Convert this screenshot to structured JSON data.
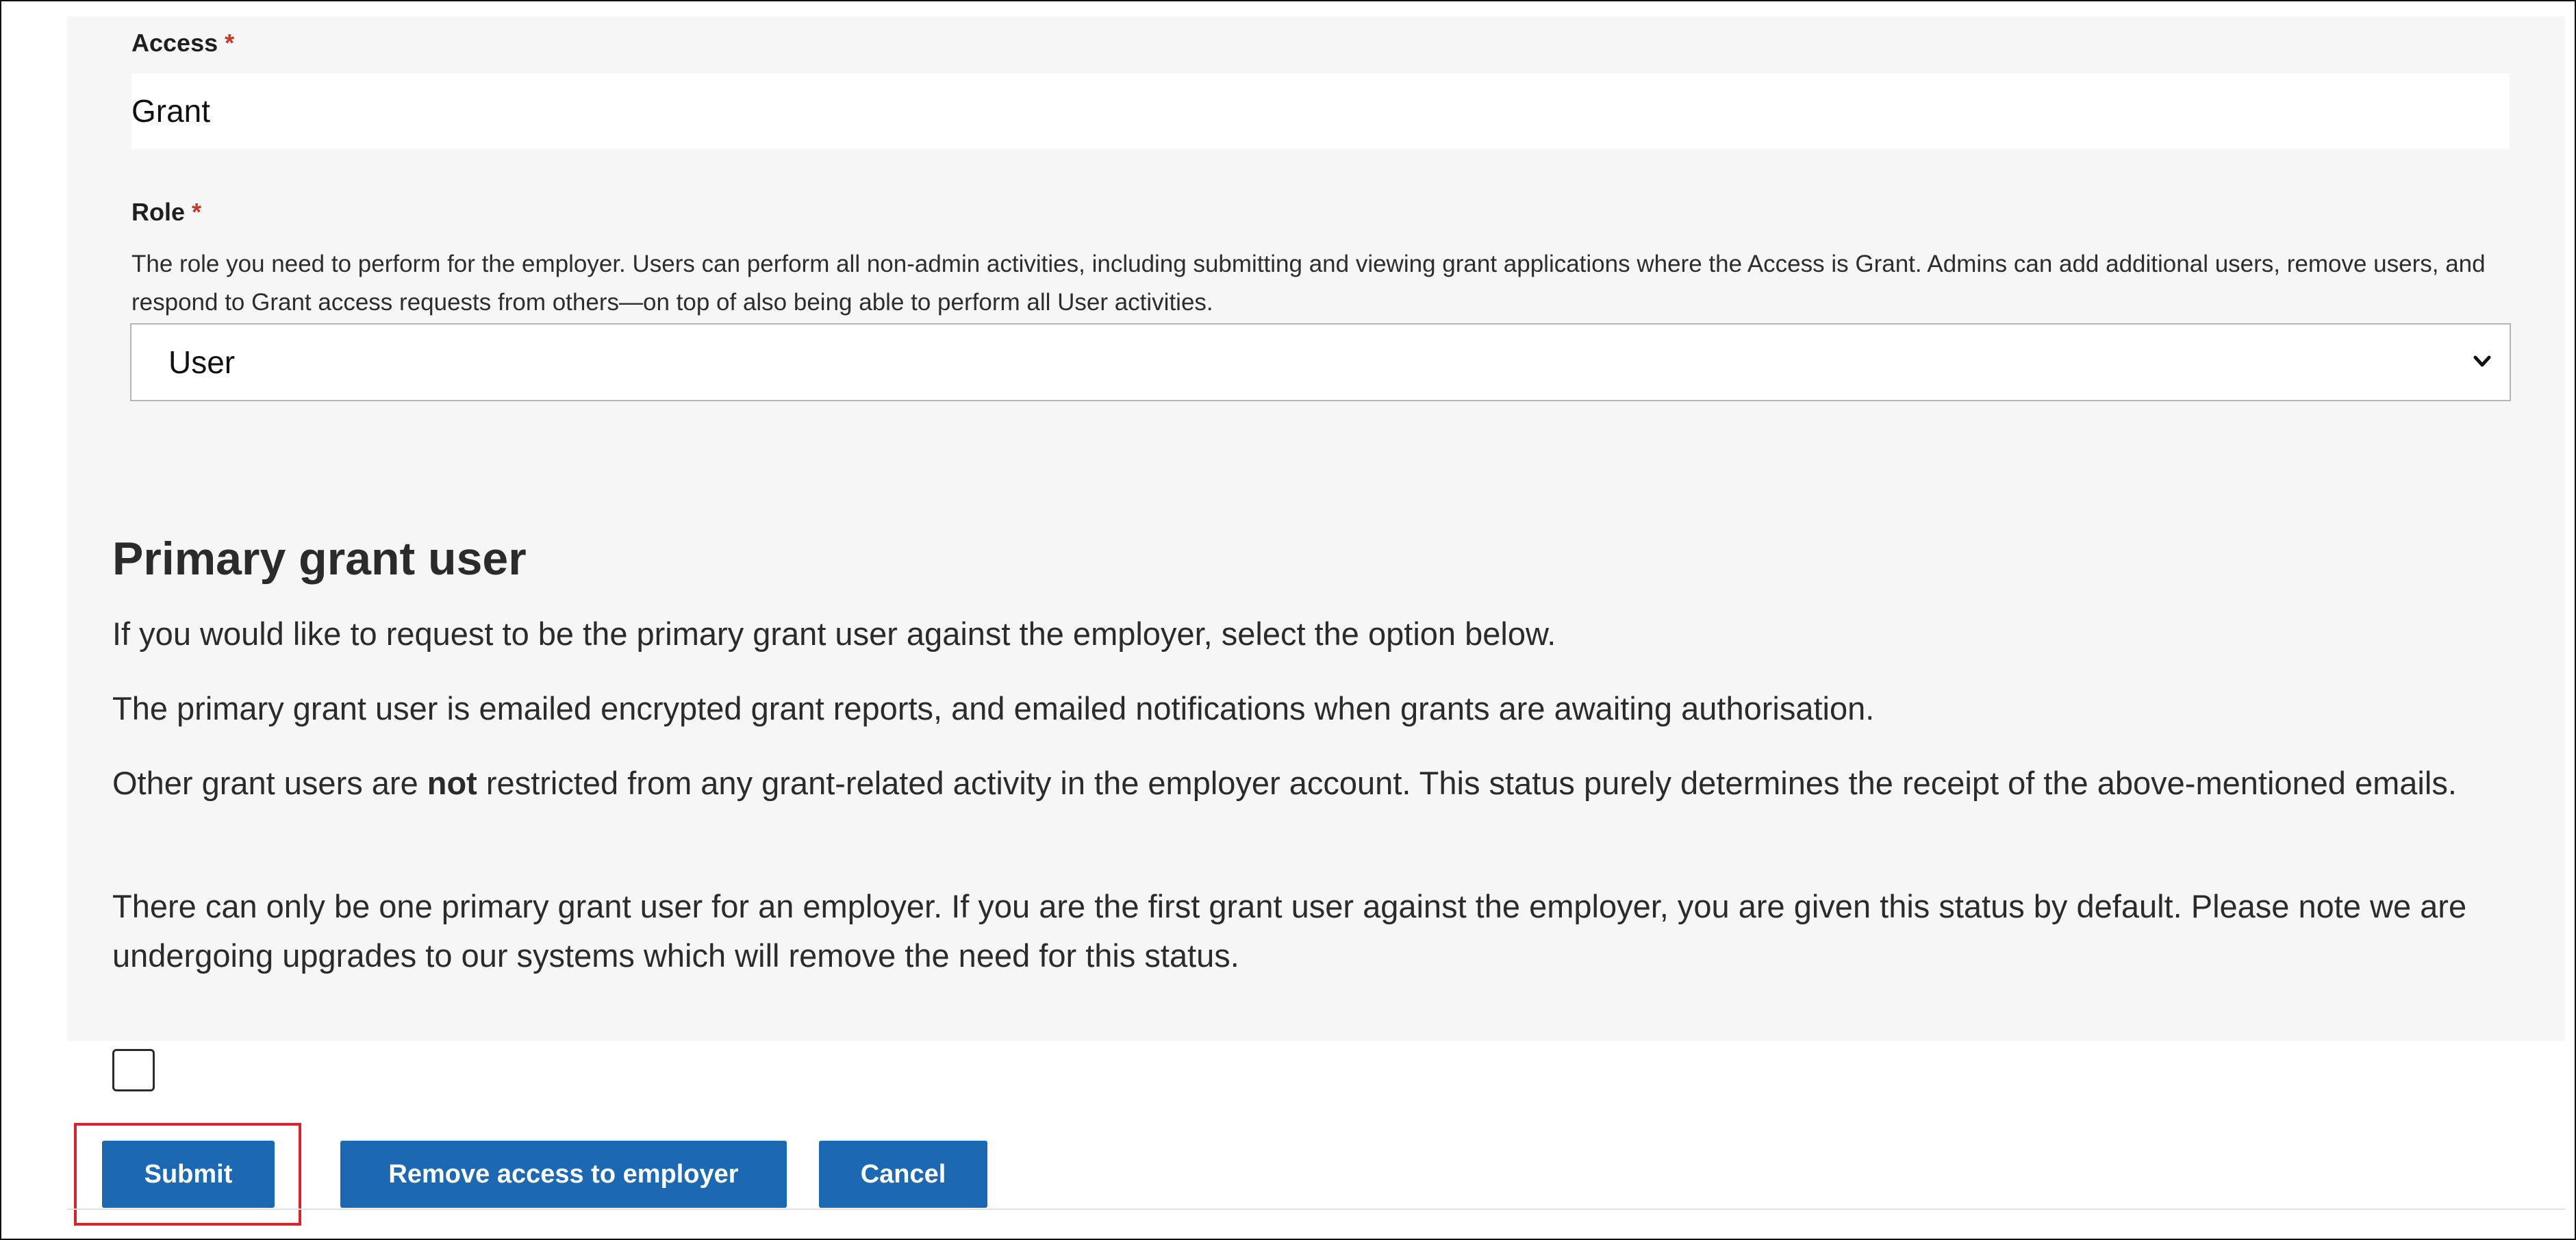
{
  "form": {
    "access": {
      "label": "Access",
      "required_marker": "*",
      "value": "Grant"
    },
    "role": {
      "label": "Role",
      "required_marker": "*",
      "hint": "The role you need to perform for the employer. Users can perform all non-admin activities, including submitting and viewing grant applications where the Access is Grant. Admins can add additional users, remove users, and respond to Grant access requests from others—on top of also being able to perform all User activities.",
      "selected": "User"
    }
  },
  "primary_grant": {
    "heading": "Primary grant user",
    "p1": "If you would like to request to be the primary grant user against the employer, select the option below.",
    "p2": "The primary grant user is emailed encrypted grant reports, and emailed notifications when grants are awaiting authorisation.",
    "p3_before": "Other grant users are ",
    "p3_bold": "not",
    "p3_after": " restricted from any grant-related activity in the employer account. This status purely determines the receipt of the above-mentioned emails.",
    "p4": "There can only be one primary grant user for an employer. If you are the first grant user against the employer, you are given this status by default. Please note we are undergoing upgrades to our systems which will remove the need for this status.",
    "checkbox_checked": false
  },
  "actions": {
    "submit_label": "Submit",
    "remove_label": "Remove access to employer",
    "cancel_label": "Cancel"
  },
  "colors": {
    "button_blue": "#1d68b3",
    "panel_grey": "#f6f6f6",
    "highlight_red": "#d9232e",
    "required_red": "#c0392b"
  }
}
